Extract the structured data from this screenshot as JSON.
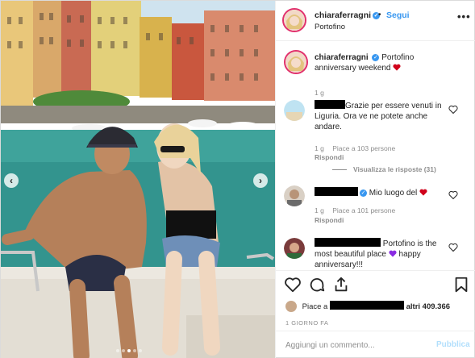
{
  "post": {
    "username": "chiaraferragni",
    "follow_label": "Segui",
    "separator": "•",
    "location": "Portofino",
    "more_label": "•••",
    "caption": "Portofino anniversary weekend",
    "caption_age": "1 g"
  },
  "comments": [
    {
      "text": "Grazie per essere venuti in Liguria. Ora ve ne potete anche andare.",
      "age": "1 g",
      "likes": "Piace a 103 persone",
      "reply": "Rispondi",
      "view_replies": "Visualizza le risposte (31)"
    },
    {
      "text": "Mio luogo del",
      "age": "1 g",
      "likes": "Piace a 101 persone",
      "reply": "Rispondi"
    },
    {
      "text": "Portofino is the most beautiful place",
      "text2": "happy anniversary!!!"
    }
  ],
  "likes": {
    "prefix": "Piace a",
    "suffix": "altri 409.366"
  },
  "time_ago": "1 GIORNO FA",
  "add_comment": {
    "placeholder": "Aggiungi un commento...",
    "publish": "Pubblica"
  },
  "colors": {
    "accent": "#3897f0",
    "heart_red": "#d0021b",
    "heart_purple": "#8a2be2",
    "text": "#262626",
    "muted": "#8e8e8e"
  },
  "icons": [
    "verified-icon",
    "heart-icon",
    "comment-icon",
    "share-icon",
    "bookmark-icon",
    "chevron-left-icon",
    "chevron-right-icon"
  ],
  "carousel": {
    "slides": 5,
    "active": 1
  }
}
